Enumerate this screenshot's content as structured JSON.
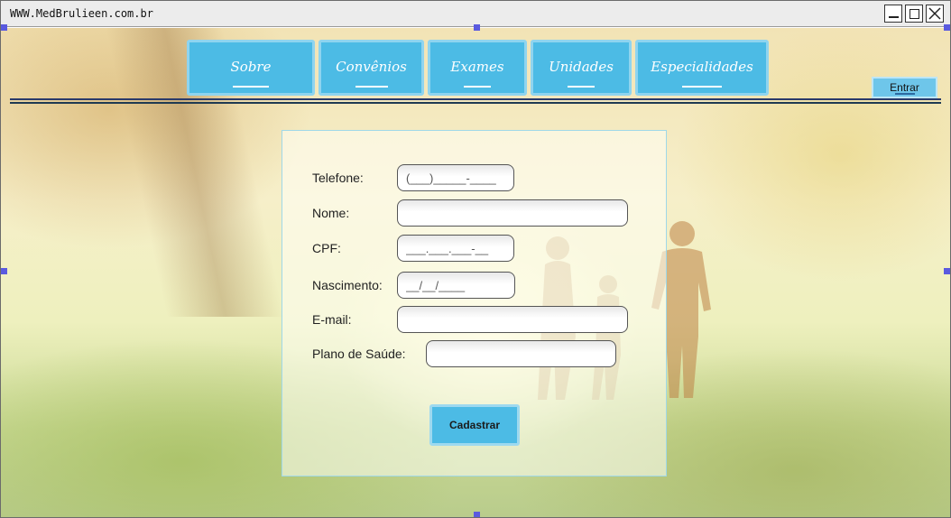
{
  "window": {
    "url": "WWW.MedBrulieen.com.br"
  },
  "nav": {
    "items": [
      {
        "label": "Sobre"
      },
      {
        "label": "Convênios"
      },
      {
        "label": "Exames"
      },
      {
        "label": "Unidades"
      },
      {
        "label": "Especialidades"
      }
    ],
    "login_label": "Entrar"
  },
  "form": {
    "telefone": {
      "label": "Telefone:",
      "value": "(___)_____-____"
    },
    "nome": {
      "label": "Nome:",
      "value": ""
    },
    "cpf": {
      "label": "CPF:",
      "value": "___.___.___-__"
    },
    "nascimento": {
      "label": "Nascimento:",
      "value": "__/__/____"
    },
    "email": {
      "label": "E-mail:",
      "value": ""
    },
    "plano": {
      "label": "Plano de Saúde:",
      "value": ""
    },
    "submit_label": "Cadastrar"
  },
  "colors": {
    "accent": "#4cbbe5",
    "accent_border": "#8fd4ef"
  }
}
